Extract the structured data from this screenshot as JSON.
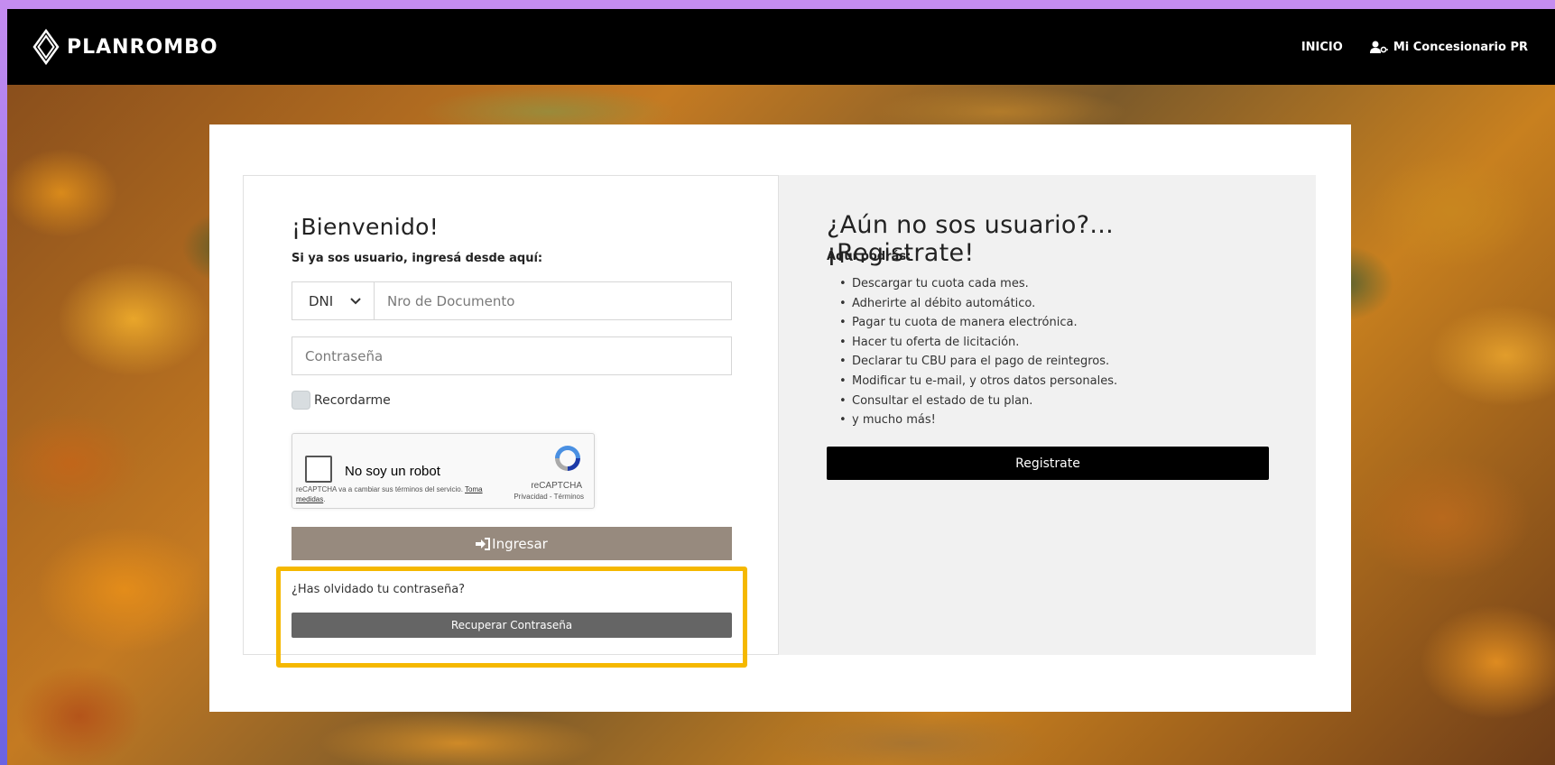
{
  "header": {
    "brand": "PLANROMBO",
    "nav_home": "INICIO",
    "nav_dealer": "Mi Concesionario PR"
  },
  "login": {
    "title": "¡Bienvenido!",
    "subtitle": "Si ya sos usuario, ingresá desde aquí:",
    "doc_type": "DNI",
    "doc_placeholder": "Nro de Documento",
    "password_placeholder": "Contraseña",
    "remember_label": "Recordarme",
    "submit_label": "Ingresar",
    "forgot_text": "¿Has olvidado tu contraseña?",
    "recover_label": "Recuperar Contraseña"
  },
  "captcha": {
    "label": "No soy un robot",
    "notice": "reCAPTCHA va a cambiar sus términos del servicio.",
    "notice_link": "Toma medidas",
    "brand": "reCAPTCHA",
    "links": "Privacidad - Términos"
  },
  "register": {
    "title": "¿Aún no sos usuario?... ¡Registrate!",
    "subtitle": "Aquí podrás:",
    "items": [
      "Descargar tu cuota cada mes.",
      "Adherirte al débito automático.",
      "Pagar tu cuota de manera electrónica.",
      "Hacer tu oferta de licitación.",
      "Declarar tu CBU para el pago de reintegros.",
      "Modificar tu e-mail, y otros datos personales.",
      "Consultar el estado de tu plan.",
      "y mucho más!"
    ],
    "button_label": "Registrate"
  },
  "colors": {
    "header_bg": "#000000",
    "submit_btn": "#978a7e",
    "recover_btn": "#656565",
    "register_btn": "#000000",
    "highlight": "#f5b800"
  }
}
